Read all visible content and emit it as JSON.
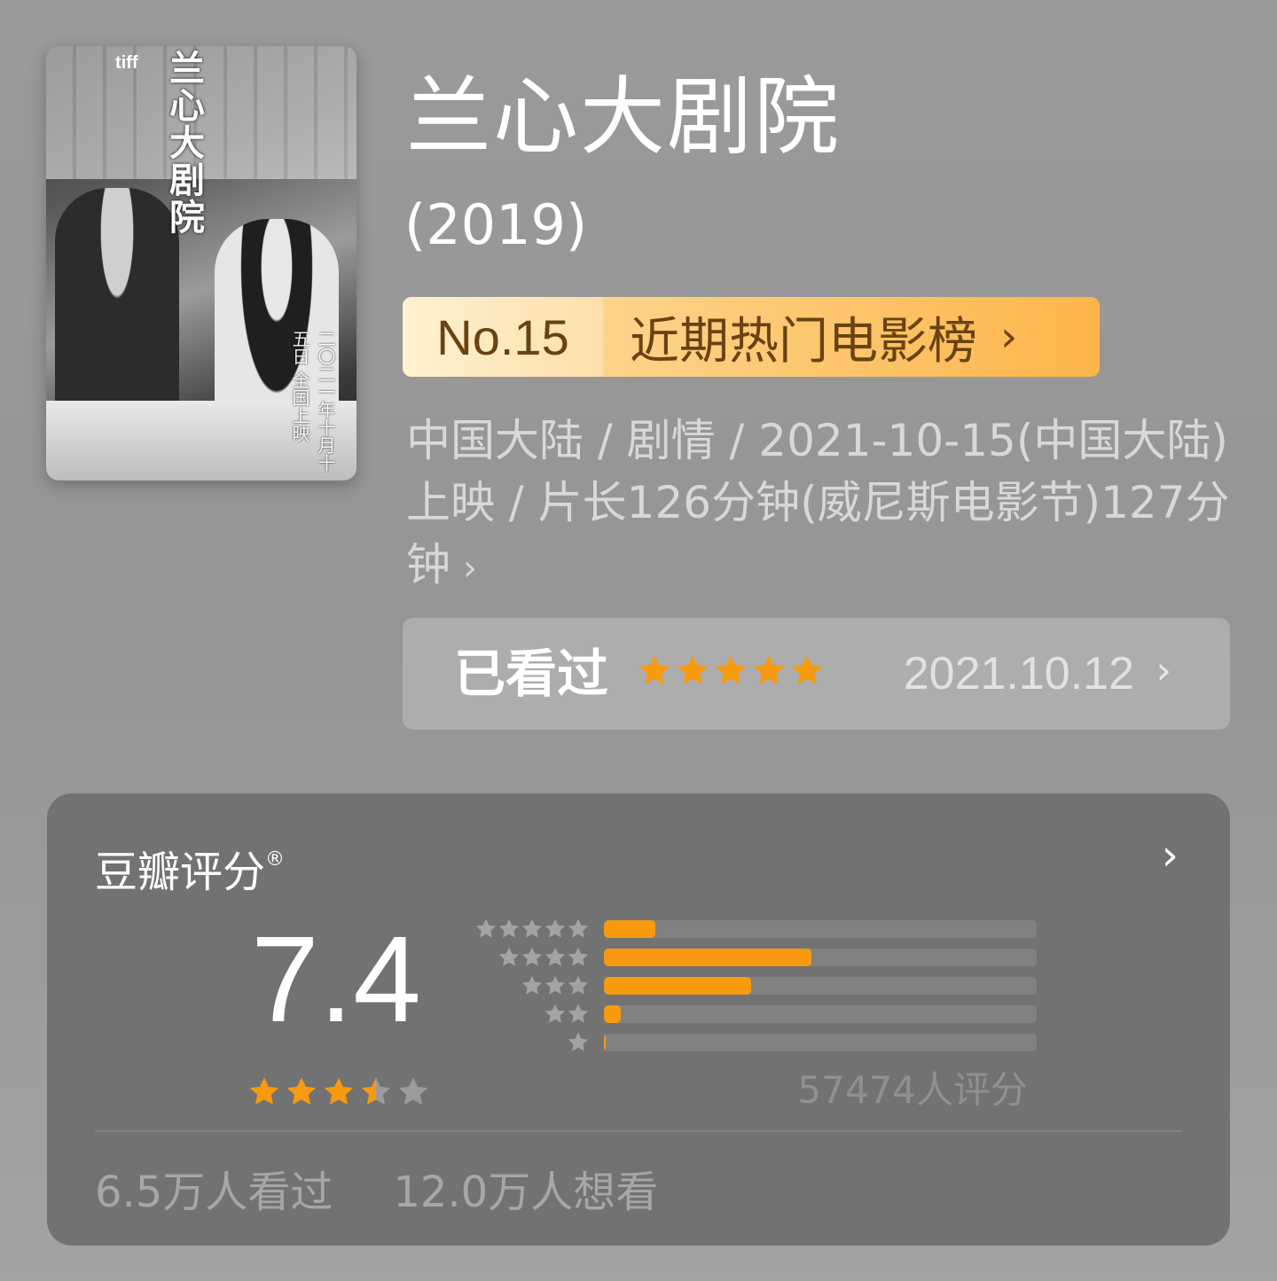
{
  "movie": {
    "title": "兰心大剧院",
    "year": "(2019)",
    "poster": {
      "title_text": "兰心大剧院",
      "logo": "tiff",
      "release_line": "二〇二一年十月十五日 全国上映"
    }
  },
  "rank": {
    "number": "No.15",
    "label": "近期热门电影榜"
  },
  "meta": {
    "text": "中国大陆 / 剧情 / 2021-10-15(中国大陆)上映 / 片长126分钟(威尼斯电影节)127分钟"
  },
  "watched": {
    "label": "已看过",
    "user_rating": 5,
    "date": "2021.10.12"
  },
  "rating_card": {
    "title": "豆瓣评分",
    "registered_mark": "®",
    "score": "7.4",
    "score_stars": 3.5,
    "distribution": [
      {
        "stars": 5,
        "fraction": 0.12
      },
      {
        "stars": 4,
        "fraction": 0.48
      },
      {
        "stars": 3,
        "fraction": 0.34
      },
      {
        "stars": 2,
        "fraction": 0.04
      },
      {
        "stars": 1,
        "fraction": 0.006
      }
    ],
    "rating_count": "57474人评分",
    "watched_count": "6.5万人看过",
    "wish_count": "12.0万人想看"
  },
  "colors": {
    "accent_orange": "#f79a0e",
    "rank_text": "#6a4312",
    "background": "#999999",
    "card_background": "#727272"
  },
  "icons": {
    "chevron": "chevron-right-icon",
    "star": "star-icon"
  }
}
